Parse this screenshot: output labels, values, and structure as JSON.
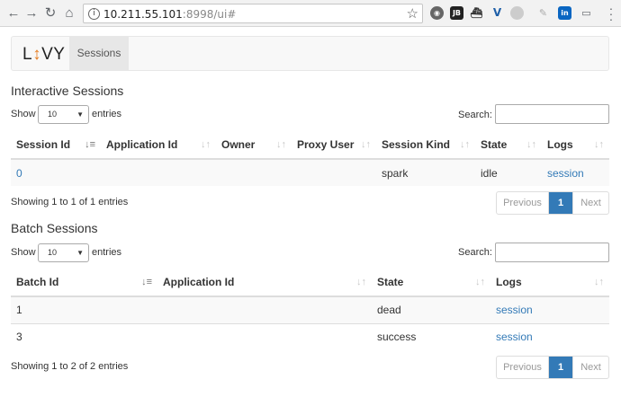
{
  "browser": {
    "url_host": "10.211.55.101",
    "url_rest": ":8998/ui#",
    "extensions": [
      "globe-ext",
      "jb-ext",
      "ship-ext",
      "v-ext",
      "circle-ext",
      "feather-ext",
      "linkedin-ext",
      "cast-ext"
    ],
    "ext_labels": {
      "jb": "JB",
      "in": "in"
    }
  },
  "navbar": {
    "brand_l": "L",
    "brand_arrow": "↕",
    "brand_rest": "VY",
    "tab_sessions": "Sessions"
  },
  "interactive": {
    "title": "Interactive Sessions",
    "show_label": "Show",
    "length_value": "10",
    "entries_label": "entries",
    "search_label": "Search:",
    "columns": [
      "Session Id",
      "Application Id",
      "Owner",
      "Proxy User",
      "Session Kind",
      "State",
      "Logs"
    ],
    "rows": [
      {
        "session_id": "0",
        "application_id": "",
        "owner": "",
        "proxy_user": "",
        "kind": "spark",
        "state": "idle",
        "logs": "session"
      }
    ],
    "info": "Showing 1 to 1 of 1 entries",
    "pager": {
      "prev": "Previous",
      "page": "1",
      "next": "Next"
    }
  },
  "batch": {
    "title": "Batch Sessions",
    "show_label": "Show",
    "length_value": "10",
    "entries_label": "entries",
    "search_label": "Search:",
    "columns": [
      "Batch Id",
      "Application Id",
      "State",
      "Logs"
    ],
    "rows": [
      {
        "batch_id": "1",
        "application_id": "",
        "state": "dead",
        "logs": "session"
      },
      {
        "batch_id": "3",
        "application_id": "",
        "state": "success",
        "logs": "session"
      }
    ],
    "info": "Showing 1 to 2 of 2 entries",
    "pager": {
      "prev": "Previous",
      "page": "1",
      "next": "Next"
    }
  },
  "colors": {
    "accent": "#337ab7",
    "brand_arrow": "#e67e22"
  }
}
